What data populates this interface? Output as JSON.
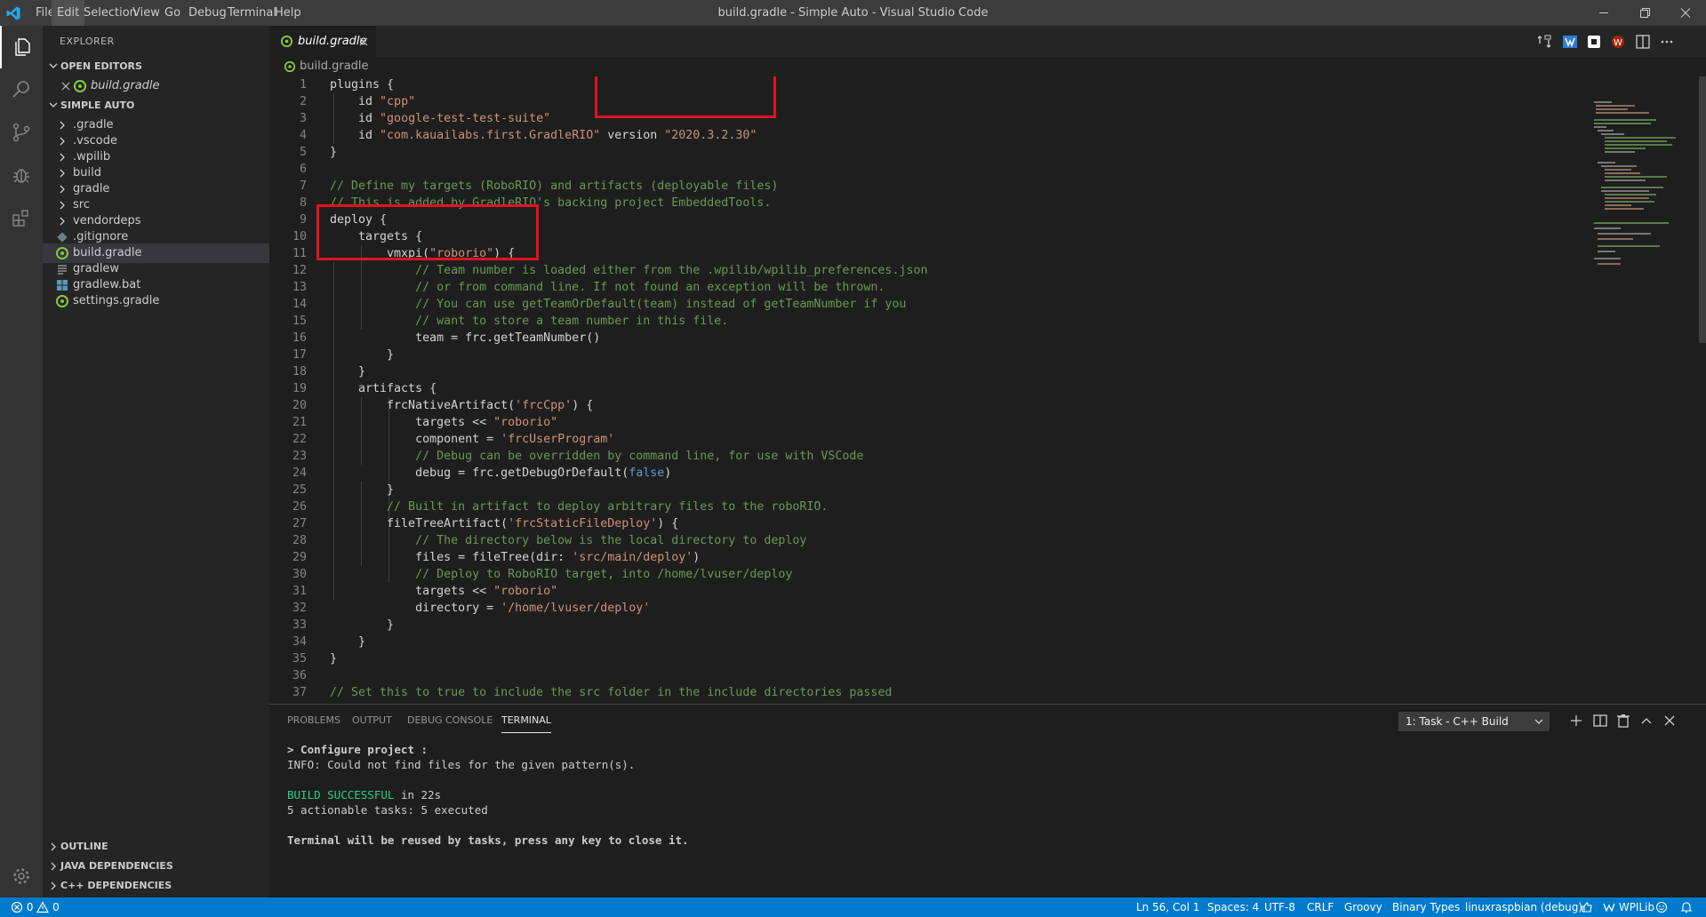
{
  "titlebar": {
    "menu": [
      "File",
      "Edit",
      "Selection",
      "View",
      "Go",
      "Debug",
      "Terminal",
      "Help"
    ],
    "title": "build.gradle - Simple Auto - Visual Studio Code"
  },
  "sidebar": {
    "title": "EXPLORER",
    "open_editors": {
      "label": "OPEN EDITORS",
      "items": [
        "build.gradle"
      ]
    },
    "workspace": {
      "label": "SIMPLE AUTO",
      "items": [
        ".gradle",
        ".vscode",
        ".wpilib",
        "build",
        "gradle",
        "src",
        "vendordeps",
        ".gitignore",
        "build.gradle",
        "gradlew",
        "gradlew.bat",
        "settings.gradle"
      ]
    },
    "bottom_sections": [
      "OUTLINE",
      "JAVA DEPENDENCIES",
      "C++ DEPENDENCIES"
    ]
  },
  "editor": {
    "tab_label": "build.gradle",
    "breadcrumb": "build.gradle",
    "line_numbers": [
      "1",
      "2",
      "3",
      "4",
      "5",
      "6",
      "7",
      "8",
      "9",
      "10",
      "11",
      "12",
      "13",
      "14",
      "15",
      "16",
      "17",
      "18",
      "19",
      "20",
      "21",
      "22",
      "23",
      "24",
      "25",
      "26",
      "27",
      "28",
      "29",
      "30",
      "31",
      "32",
      "33",
      "34",
      "35",
      "36",
      "37"
    ],
    "code": {
      "l1": "plugins {",
      "l2a": "    id ",
      "l2b": "\"cpp\"",
      "l3a": "    id ",
      "l3b": "\"google-test-test-suite\"",
      "l4a": "    id ",
      "l4b": "\"com.kauailabs.first.GradleRIO\"",
      "l4c": " version ",
      "l4d": "\"2020.3.2.30\"",
      "l5": "}",
      "l6": "",
      "l7": "// Define my targets (RoboRIO) and artifacts (deployable files)",
      "l8": "// This is added by GradleRIO's backing project EmbeddedTools.",
      "l9": "deploy {",
      "l10": "    targets {",
      "l11a": "        vmxpi(",
      "l11b": "\"roborio\"",
      "l11c": ") {",
      "l12": "            // Team number is loaded either from the .wpilib/wpilib_preferences.json",
      "l13": "            // or from command line. If not found an exception will be thrown.",
      "l14": "            // You can use getTeamOrDefault(team) instead of getTeamNumber if you",
      "l15": "            // want to store a team number in this file.",
      "l16": "            team = frc.getTeamNumber()",
      "l17": "        }",
      "l18": "    }",
      "l19": "    artifacts {",
      "l20a": "        frcNativeArtifact(",
      "l20b": "'frcCpp'",
      "l20c": ") {",
      "l21a": "            targets << ",
      "l21b": "\"roborio\"",
      "l22a": "            component = ",
      "l22b": "'frcUserProgram'",
      "l23": "            // Debug can be overridden by command line, for use with VSCode",
      "l24a": "            debug = frc.getDebugOrDefault(",
      "l24b": "false",
      "l24c": ")",
      "l25": "        }",
      "l26": "        // Built in artifact to deploy arbitrary files to the roboRIO.",
      "l27a": "        fileTreeArtifact(",
      "l27b": "'frcStaticFileDeploy'",
      "l27c": ") {",
      "l28": "            // The directory below is the local directory to deploy",
      "l29a": "            files = fileTree(dir: ",
      "l29b": "'src/main/deploy'",
      "l29c": ")",
      "l30": "            // Deploy to RoboRIO target, into /home/lvuser/deploy",
      "l31a": "            targets << ",
      "l31b": "\"roborio\"",
      "l32a": "            directory = ",
      "l32b": "'/home/lvuser/deploy'",
      "l33": "        }",
      "l34": "    }",
      "l35": "}",
      "l36": "",
      "l37": "// Set this to true to include the src folder in the include directories passed"
    }
  },
  "panel": {
    "tabs": [
      "PROBLEMS",
      "OUTPUT",
      "DEBUG CONSOLE",
      "TERMINAL"
    ],
    "task_select": "1: Task - C++ Build",
    "terminal": {
      "line1": "> Configure project :",
      "line2": "INFO: Could not find files for the given pattern(s).",
      "line3a": "BUILD SUCCESSFUL",
      "line3b": " in 22s",
      "line4": "5 actionable tasks: 5 executed",
      "line5": "Terminal will be reused by tasks, press any key to close it."
    }
  },
  "statusbar": {
    "errors": "0",
    "warnings": "0",
    "position": "Ln 56, Col 1",
    "spaces": "Spaces: 4",
    "encoding": "UTF-8",
    "eol": "CRLF",
    "language": "Groovy",
    "binary_types": "Binary Types",
    "config": "linuxraspbian (debug)",
    "wpilib": "WPILib"
  },
  "colors": {
    "accent": "#007acc",
    "highlight_box": "#e0141e",
    "gradle_icon": "#8dc63f"
  }
}
